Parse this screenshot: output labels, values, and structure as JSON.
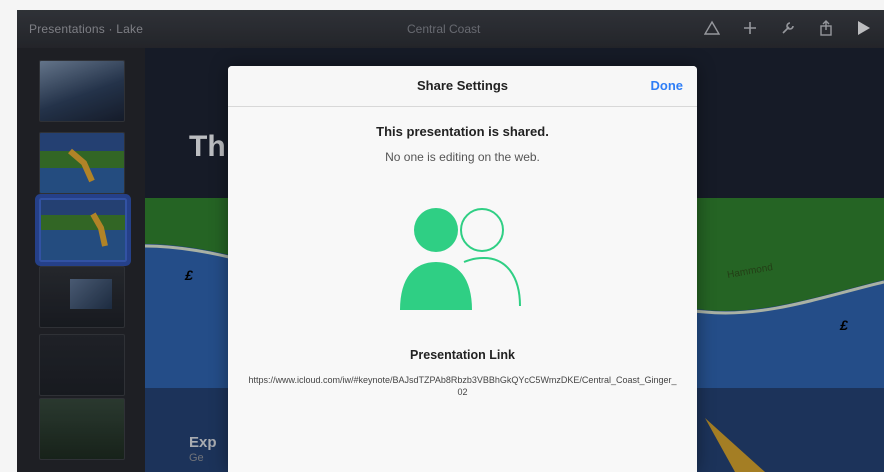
{
  "toolbar": {
    "title": "Presentations · Lake",
    "document_name": "Central Coast"
  },
  "slide": {
    "title": "Th",
    "subtitle": "Exp",
    "caption": "Ge",
    "map_label": "Hammond"
  },
  "modal": {
    "title": "Share Settings",
    "done_label": "Done",
    "shared_status": "This presentation is shared.",
    "editing_status": "No one is editing on the web.",
    "link_heading": "Presentation Link",
    "link_url": "https://www.icloud.com/iw/#keynote/BAJsdTZPAb8Rbzb3VBBhGkQYcC5WmzDKE/Central_Coast_Ginger_02"
  },
  "colors": {
    "accent": "#2f7ef6",
    "share_green": "#2fcf84",
    "selection": "#3d64c8"
  }
}
